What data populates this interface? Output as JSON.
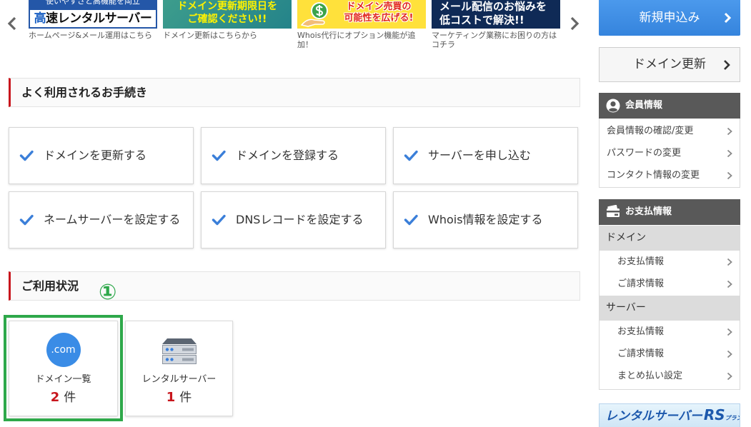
{
  "colors": {
    "accent_red": "#c8161d",
    "check_blue": "#3b7fd9",
    "primary_blue": "#3a8ce6",
    "highlight_green": "#2ea84a",
    "panel_header": "#595959"
  },
  "carousel": {
    "prev_icon": "chevron-left-icon",
    "next_icon": "chevron-right-icon",
    "banners": [
      {
        "top_line": "使いやすさと高機能を両立",
        "title_accent": "高",
        "title_rest": "速レンタルサーバー",
        "caption_lines": [
          "ホームページ&メール運用はこちら"
        ]
      },
      {
        "lines": [
          "ドメイン更新期限日を",
          "ご確認ください!!"
        ],
        "caption_lines": [
          "ドメイン更新はこちらから"
        ]
      },
      {
        "icon": "coin-hand-icon",
        "lines": [
          "ドメイン売買の",
          "可能性を広げる!"
        ],
        "caption_lines": [
          "Whois代行にオプション機能が追",
          "加！"
        ]
      },
      {
        "lines": [
          "メール配信のお悩みを",
          "低コストで解決!!"
        ],
        "caption_lines": [
          "マーケティング業務にお困りの方は",
          "コチラ"
        ]
      }
    ]
  },
  "procedures": {
    "title": "よく利用されるお手続き",
    "icon": "check-icon",
    "items": [
      {
        "label": "ドメインを更新する"
      },
      {
        "label": "ドメインを登録する"
      },
      {
        "label": "サーバーを申し込む"
      },
      {
        "label": "ネームサーバーを設定する"
      },
      {
        "label": "DNSレコードを設定する"
      },
      {
        "label": "Whois情報を設定する"
      }
    ]
  },
  "usage": {
    "title": "ご利用状況",
    "marker": "①",
    "cards": [
      {
        "icon": "dot-com-icon",
        "icon_text": ".com",
        "label": "ドメイン一覧",
        "count": 2,
        "unit": "件",
        "highlighted": true
      },
      {
        "icon": "server-icon",
        "label": "レンタルサーバー",
        "count": 1,
        "unit": "件",
        "highlighted": false
      }
    ]
  },
  "sidebar": {
    "new_application": "新規申込み",
    "domain_renewal": "ドメイン更新",
    "member_info": {
      "icon": "user-icon",
      "title": "会員情報",
      "items": [
        "会員情報の確認/変更",
        "パスワードの変更",
        "コンタクト情報の変更"
      ]
    },
    "payment_info": {
      "icon": "wallet-icon",
      "title": "お支払情報",
      "groups": [
        {
          "name": "ドメイン",
          "items": [
            "お支払情報",
            "ご請求情報"
          ]
        },
        {
          "name": "サーバー",
          "items": [
            "お支払情報",
            "ご請求情報",
            "まとめ払い設定"
          ]
        }
      ]
    },
    "banner": {
      "main": "レンタルサーバー",
      "accent": "RS",
      "suffix": "プラン"
    }
  }
}
